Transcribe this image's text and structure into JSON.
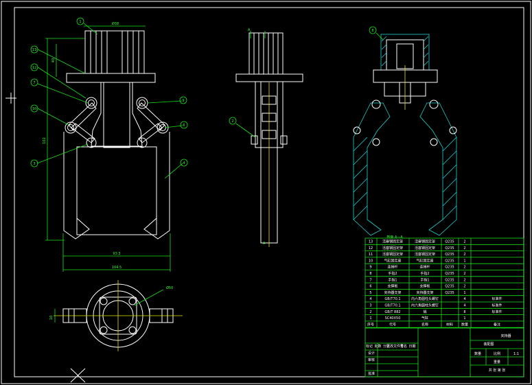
{
  "section_label": "剖面 A—A",
  "view_marks": {
    "a": "A",
    "b": "A"
  },
  "dims": {
    "top_width": "Ø38",
    "left_height": "102",
    "left_upper": "40",
    "bottom_inner": "93.3",
    "bottom_outer": "104.5",
    "small_height": "10",
    "diameter": "Ø50"
  },
  "balloons": [
    "1",
    "13",
    "12",
    "7",
    "10",
    "9",
    "6",
    "3",
    "4",
    "2",
    "8"
  ],
  "bom": {
    "headers": [
      "序号",
      "代号",
      "名称",
      "数量",
      "材料",
      "备注"
    ],
    "rows": [
      {
        "no": "13",
        "code": "活塞钢固定架",
        "name": "活塞钢固定架",
        "qty": "2",
        "mat": "Q235",
        "note": ""
      },
      {
        "no": "12",
        "code": "活塞钢固定架",
        "name": "活塞钢固定架",
        "qty": "2",
        "mat": "Q235",
        "note": ""
      },
      {
        "no": "11",
        "code": "活塞钢固定架",
        "name": "活塞钢固定架",
        "qty": "2",
        "mat": "Q235",
        "note": ""
      },
      {
        "no": "10",
        "code": "气缸固定座",
        "name": "气缸固定座",
        "qty": "1",
        "mat": "Q235",
        "note": ""
      },
      {
        "no": "9",
        "code": "连接杆",
        "name": "连接杆",
        "qty": "2",
        "mat": "Q235",
        "note": ""
      },
      {
        "no": "8",
        "code": "手指2",
        "name": "手指2",
        "qty": "2",
        "mat": "Q235",
        "note": ""
      },
      {
        "no": "7",
        "code": "手指1",
        "name": "手指1",
        "qty": "2",
        "mat": "Q235",
        "note": ""
      },
      {
        "no": "6",
        "code": "支撑板",
        "name": "支撑板",
        "qty": "2",
        "mat": "Q235",
        "note": ""
      },
      {
        "no": "5",
        "code": "夹持器支架",
        "name": "夹持器支架",
        "qty": "1",
        "mat": "Q235",
        "note": ""
      },
      {
        "no": "4",
        "code": "GB/T70.1",
        "name": "内六角圆柱头螺钉",
        "qty": "4",
        "mat": "",
        "note": "标准件"
      },
      {
        "no": "3",
        "code": "GB/T70.1",
        "name": "内六角圆柱头螺钉",
        "qty": "4",
        "mat": "",
        "note": "标准件"
      },
      {
        "no": "2",
        "code": "GB/T 882",
        "name": "销",
        "qty": "8",
        "mat": "",
        "note": "标准件"
      },
      {
        "no": "1",
        "code": "SC40X50",
        "name": "气缸",
        "qty": "1",
        "mat": "",
        "note": ""
      }
    ]
  },
  "title_block": {
    "part_name": "夹持器",
    "scale": "1:1",
    "sheet_info": "共 张 第 张",
    "label_scale": "比例",
    "label_qty": "数量",
    "label_weight": "重量",
    "drawing_no": "装配图",
    "designer_label": "设计",
    "checker_label": "审核",
    "approve_label": "批准",
    "grid_labels": [
      "标记",
      "处数",
      "分区",
      "更改文件号",
      "签名",
      "日期"
    ]
  },
  "colors": {
    "outline": "#ffffff",
    "dimension": "#18e418",
    "hatch": "#22d3d3",
    "center": "#e8e800",
    "table": "#18e418",
    "background": "#000000"
  }
}
